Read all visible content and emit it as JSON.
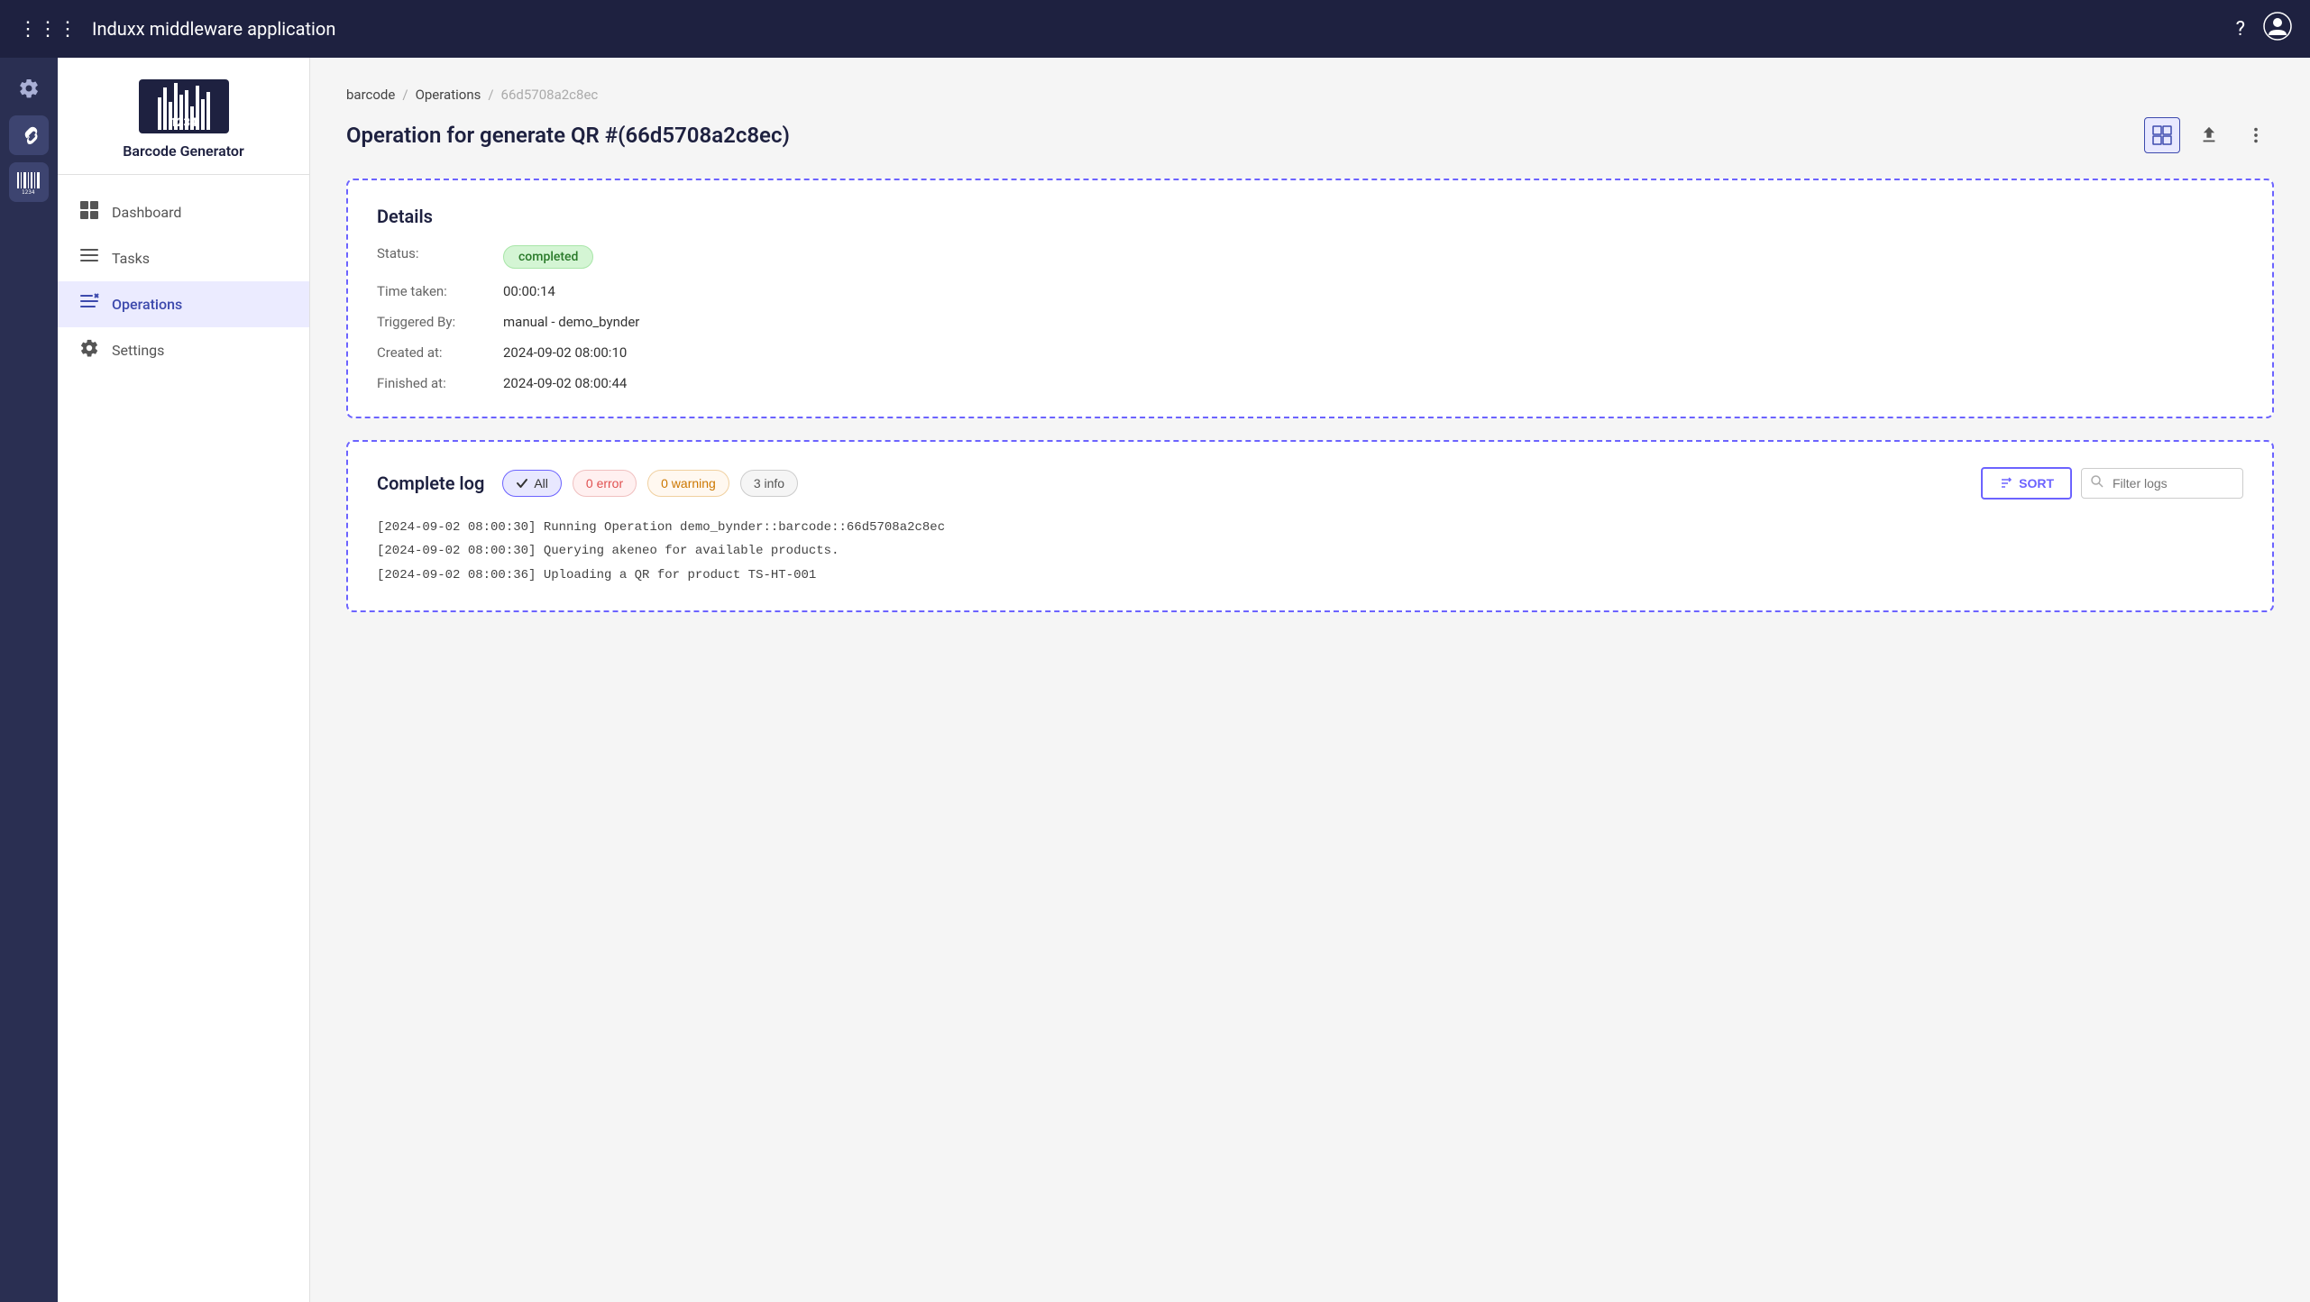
{
  "app": {
    "title": "Induxx middleware application"
  },
  "breadcrumb": {
    "items": [
      "barcode",
      "Operations"
    ],
    "current": "66d5708a2c8ec"
  },
  "page": {
    "title": "Operation for generate QR #(66d5708a2c8ec)"
  },
  "details": {
    "section_title": "Details",
    "fields": [
      {
        "label": "Status:",
        "value": "completed",
        "type": "badge"
      },
      {
        "label": "Time taken:",
        "value": "00:00:14"
      },
      {
        "label": "Triggered By:",
        "value": "manual - demo_bynder"
      },
      {
        "label": "Created at:",
        "value": "2024-09-02 08:00:10"
      },
      {
        "label": "Finished at:",
        "value": "2024-09-02 08:00:44"
      }
    ]
  },
  "log": {
    "section_title": "Complete log",
    "filters": [
      {
        "id": "all",
        "label": "All",
        "active": true
      },
      {
        "id": "error",
        "label": "0 error",
        "active": false
      },
      {
        "id": "warning",
        "label": "0 warning",
        "active": false
      },
      {
        "id": "info",
        "label": "3 info",
        "active": false
      }
    ],
    "sort_label": "SORT",
    "filter_placeholder": "Filter logs",
    "entries": [
      "[2024-09-02 08:00:30] Running Operation demo_bynder::barcode::66d5708a2c8ec",
      "[2024-09-02 08:00:30] Querying akeneo for available products.",
      "[2024-09-02 08:00:36] Uploading a QR for product TS-HT-001"
    ]
  },
  "sidebar": {
    "app_name": "Barcode Generator",
    "nav_items": [
      {
        "id": "dashboard",
        "label": "Dashboard",
        "icon": "⊞"
      },
      {
        "id": "tasks",
        "label": "Tasks",
        "icon": "☰"
      },
      {
        "id": "operations",
        "label": "Operations",
        "icon": "≡"
      },
      {
        "id": "settings",
        "label": "Settings",
        "icon": "⚙"
      }
    ]
  },
  "icons": {
    "grid": "⋮⋮⋮",
    "help": "?",
    "user": "👤",
    "table": "▦",
    "download": "⬇",
    "more": "⋮",
    "check": "✓",
    "sort": "⇅",
    "search": "🔍"
  }
}
